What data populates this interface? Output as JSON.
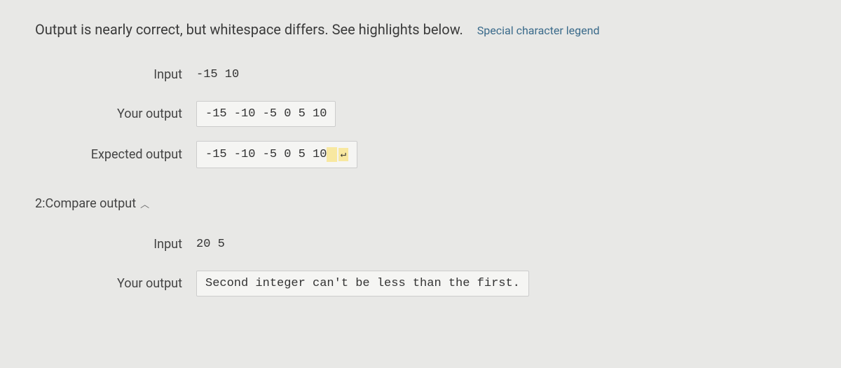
{
  "status": {
    "message": "Output is nearly correct, but whitespace differs. See highlights below.",
    "legend_link": "Special character legend"
  },
  "test1": {
    "input_label": "Input",
    "input_value": "-15 10",
    "your_output_label": "Your output",
    "your_output_value": "-15 -10 -5 0 5 10",
    "expected_output_label": "Expected output",
    "expected_output_prefix": "-15 -10 -5 0 5 10",
    "expected_output_highlighted": " ",
    "newline_glyph": "↵"
  },
  "section2": {
    "title": "2:Compare output"
  },
  "test2": {
    "input_label": "Input",
    "input_value": "20 5",
    "your_output_label": "Your output",
    "your_output_value": "Second integer can't be less than the first."
  }
}
